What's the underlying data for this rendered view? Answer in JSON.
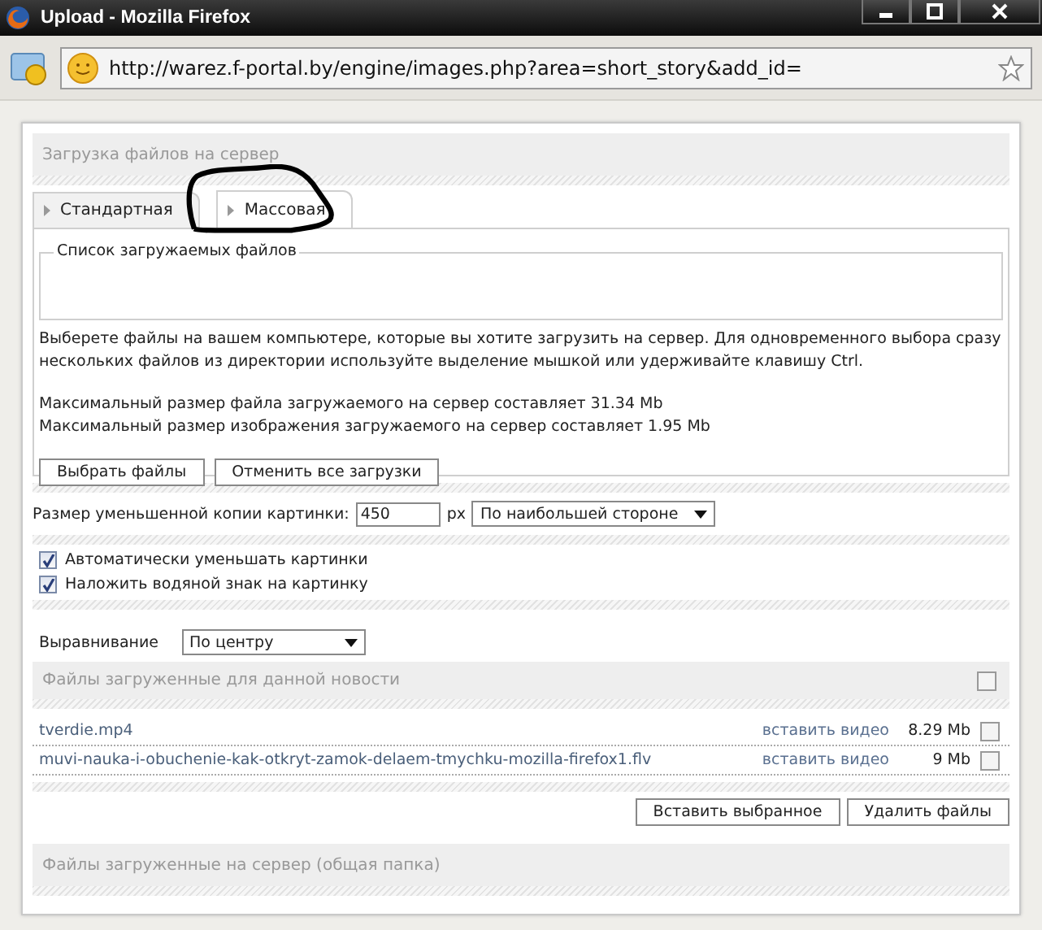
{
  "window": {
    "title": "Upload - Mozilla Firefox"
  },
  "address_bar": {
    "url": "http://warez.f-portal.by/engine/images.php?area=short_story&add_id="
  },
  "upload_panel": {
    "title": "Загрузка файлов на сервер",
    "tabs": [
      {
        "label": "Стандартная",
        "selected": false
      },
      {
        "label": "Массовая",
        "selected": true
      }
    ],
    "file_list": {
      "legend": "Список загружаемых файлов"
    },
    "instructions": "Выберете файлы на вашем компьютере, которые вы хотите загрузить на сервер. Для одновременного выбора сразу нескольких файлов из директории используйте выделение мышкой или удерживайте клавишу Ctrl.",
    "limits": [
      "Максимальный размер файла загружаемого на сервер составляет 31.34 Mb",
      "Максимальный размер изображения загружаемого на сервер составляет 1.95 Mb"
    ],
    "buttons": [
      "Выбрать файлы",
      "Отменить все загрузки"
    ]
  },
  "thumbnail": {
    "label": "Размер уменьшенной копии картинки:",
    "value": "450",
    "unit": "px",
    "mode": "По наибольшей стороне"
  },
  "options": [
    {
      "label": "Автоматически уменьшать картинки",
      "checked": true
    },
    {
      "label": "Наложить водяной знак на картинку",
      "checked": true
    }
  ],
  "alignment": {
    "label": "Выравнивание",
    "value": "По центру"
  },
  "news_files": {
    "title": "Файлы загруженные для данной новости",
    "select_all": false,
    "files": [
      {
        "name": "tverdie.mp4",
        "action": "вставить видео",
        "size": "8.29 Mb",
        "checked": false
      },
      {
        "name": "muvi-nauka-i-obuchenie-kak-otkryt-zamok-delaem-tmychku-mozilla-firefox1.flv",
        "action": "вставить видео",
        "size": "9 Mb",
        "checked": false
      }
    ],
    "buttons": [
      "Вставить выбранное",
      "Удалить файлы"
    ]
  },
  "server_files": {
    "title": "Файлы загруженные на сервер (общая папка)"
  }
}
